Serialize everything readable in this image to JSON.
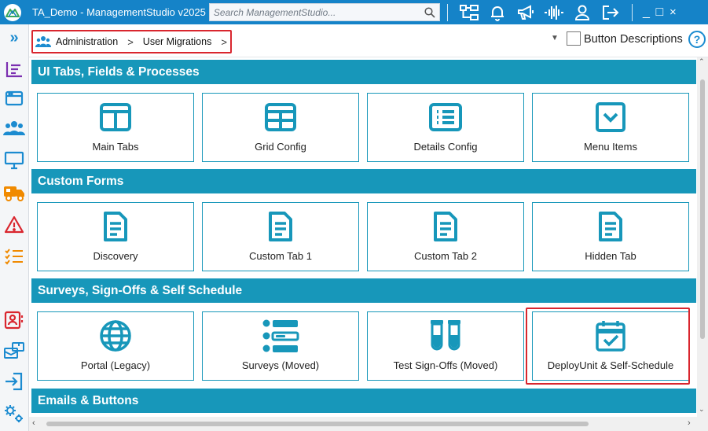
{
  "window": {
    "title": "TA_Demo - ManagementStudio v2025",
    "search_placeholder": "Search ManagementStudio...",
    "toolbar_icons": [
      "hierarchy-icon",
      "bell-icon",
      "megaphone-icon",
      "pulse-icon",
      "user-icon",
      "logout-icon"
    ],
    "controls": {
      "minimize": "_",
      "maximize": "□",
      "close": "×"
    }
  },
  "sidebar": {
    "expand_glyph": "»",
    "items": [
      "list-icon",
      "window-icon",
      "users-icon",
      "monitor-icon",
      "truck-icon",
      "warning-icon",
      "checklist-icon",
      "contact-card-icon",
      "transfer-icon",
      "import-icon",
      "settings-gears-icon"
    ]
  },
  "breadcrumb": {
    "items": [
      "Administration",
      "User Migrations"
    ],
    "separator": ">"
  },
  "header_controls": {
    "dropdown_caret": "▼",
    "button_descriptions_label": "Button Descriptions",
    "button_descriptions_checked": false,
    "help": "?"
  },
  "sections": [
    {
      "title": "UI Tabs, Fields & Processes",
      "tiles": [
        {
          "label": "Main Tabs",
          "icon": "columns-icon"
        },
        {
          "label": "Grid Config",
          "icon": "grid-icon"
        },
        {
          "label": "Details Config",
          "icon": "details-list-icon"
        },
        {
          "label": "Menu Items",
          "icon": "chevron-box-icon"
        }
      ]
    },
    {
      "title": "Custom Forms",
      "tiles": [
        {
          "label": "Discovery",
          "icon": "document-icon"
        },
        {
          "label": "Custom Tab 1",
          "icon": "document-icon"
        },
        {
          "label": "Custom Tab 2",
          "icon": "document-icon"
        },
        {
          "label": "Hidden Tab",
          "icon": "document-icon"
        }
      ]
    },
    {
      "title": "Surveys, Sign-Offs & Self Schedule",
      "tiles": [
        {
          "label": "Portal (Legacy)",
          "icon": "globe-icon"
        },
        {
          "label": "Surveys (Moved)",
          "icon": "survey-icon"
        },
        {
          "label": "Test Sign-Offs (Moved)",
          "icon": "test-tubes-icon"
        },
        {
          "label": "DeployUnit & Self-Schedule",
          "icon": "calendar-check-icon"
        }
      ]
    },
    {
      "title": "Emails & Buttons",
      "tiles": []
    }
  ],
  "colors": {
    "titlebar": "#1583c8",
    "section_header": "#1797ba",
    "tile_icon": "#1797ba",
    "highlight": "#d9262e",
    "sidebar_purple": "#7b2fb1",
    "sidebar_blue": "#1b8bd0",
    "sidebar_orange": "#f08a00",
    "sidebar_red": "#d9262e"
  }
}
